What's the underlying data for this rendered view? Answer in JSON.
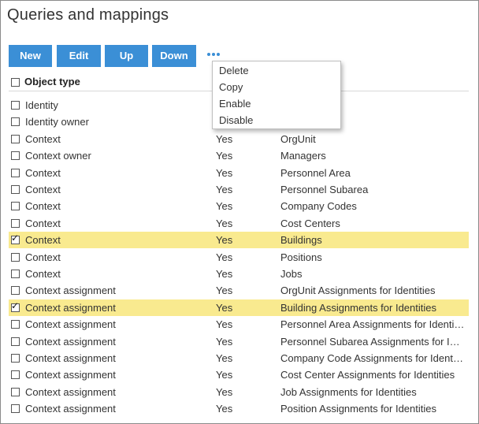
{
  "page": {
    "title": "Queries and mappings"
  },
  "toolbar": {
    "buttons": [
      "New",
      "Edit",
      "Up",
      "Down"
    ]
  },
  "table": {
    "header": "Object type",
    "rows": [
      {
        "type": "Identity",
        "flag": "",
        "name": "",
        "checked": false
      },
      {
        "type": "Identity owner",
        "flag": "",
        "name": "",
        "checked": false
      },
      {
        "type": "Context",
        "flag": "Yes",
        "name": "OrgUnit",
        "checked": false
      },
      {
        "type": "Context owner",
        "flag": "Yes",
        "name": "Managers",
        "checked": false
      },
      {
        "type": "Context",
        "flag": "Yes",
        "name": "Personnel Area",
        "checked": false
      },
      {
        "type": "Context",
        "flag": "Yes",
        "name": "Personnel Subarea",
        "checked": false
      },
      {
        "type": "Context",
        "flag": "Yes",
        "name": "Company Codes",
        "checked": false
      },
      {
        "type": "Context",
        "flag": "Yes",
        "name": "Cost Centers",
        "checked": false
      },
      {
        "type": "Context",
        "flag": "Yes",
        "name": "Buildings",
        "checked": true
      },
      {
        "type": "Context",
        "flag": "Yes",
        "name": "Positions",
        "checked": false
      },
      {
        "type": "Context",
        "flag": "Yes",
        "name": "Jobs",
        "checked": false
      },
      {
        "type": "Context assignment",
        "flag": "Yes",
        "name": "OrgUnit Assignments for Identities",
        "checked": false
      },
      {
        "type": "Context assignment",
        "flag": "Yes",
        "name": "Building Assignments for Identities",
        "checked": true
      },
      {
        "type": "Context assignment",
        "flag": "Yes",
        "name": "Personnel Area Assignments for Identiti...",
        "checked": false
      },
      {
        "type": "Context assignment",
        "flag": "Yes",
        "name": "Personnel Subarea Assignments for Ide...",
        "checked": false
      },
      {
        "type": "Context assignment",
        "flag": "Yes",
        "name": "Company Code Assignments for Identiti...",
        "checked": false
      },
      {
        "type": "Context assignment",
        "flag": "Yes",
        "name": "Cost Center Assignments for Identities",
        "checked": false
      },
      {
        "type": "Context assignment",
        "flag": "Yes",
        "name": "Job Assignments for Identities",
        "checked": false
      },
      {
        "type": "Context assignment",
        "flag": "Yes",
        "name": "Position Assignments for Identities",
        "checked": false
      }
    ]
  },
  "menu": {
    "items": [
      "Delete",
      "Copy",
      "Enable",
      "Disable"
    ]
  },
  "colors": {
    "accent": "#3b8fd6",
    "selected_row": "#f9ea8f"
  },
  "icons": {
    "more": "more-horizontal-icon"
  }
}
